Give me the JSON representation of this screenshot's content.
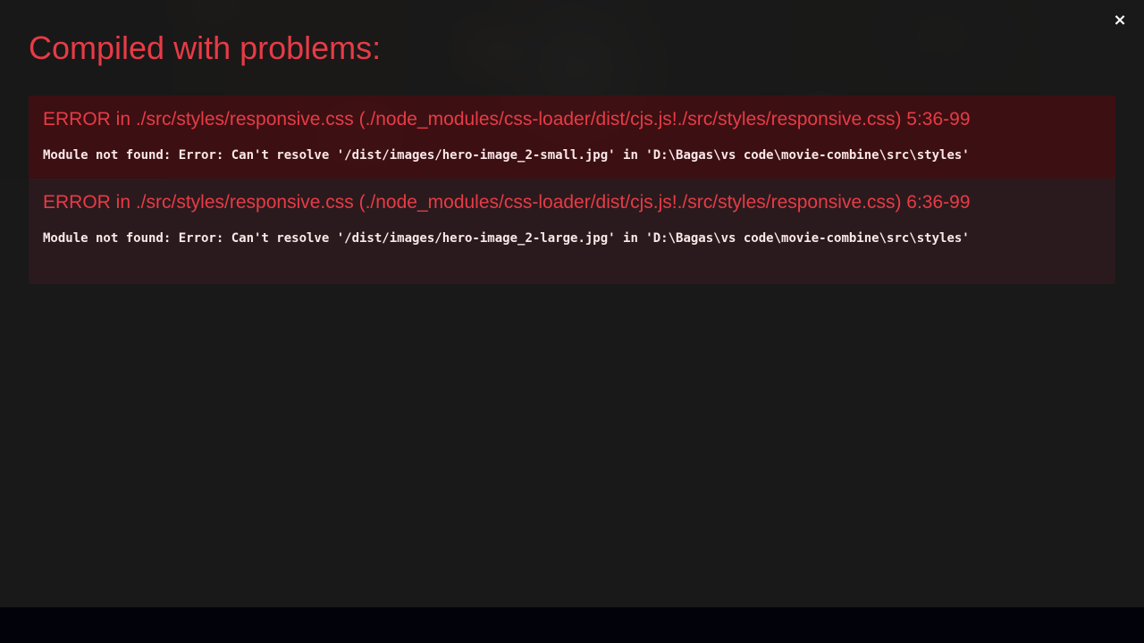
{
  "overlay": {
    "title": "Compiled with problems:",
    "close_label": "×"
  },
  "errors": [
    {
      "header": "ERROR in ./src/styles/responsive.css (./node_modules/css-loader/dist/cjs.js!./src/styles/responsive.css) 5:36-99",
      "message": "Module not found: Error: Can't resolve '/dist/images/hero-image_2-small.jpg' in 'D:\\Bagas\\vs code\\movie-combine\\src\\styles'"
    },
    {
      "header": "ERROR in ./src/styles/responsive.css (./node_modules/css-loader/dist/cjs.js!./src/styles/responsive.css) 6:36-99",
      "message": "Module not found: Error: Can't resolve '/dist/images/hero-image_2-large.jpg' in 'D:\\Bagas\\vs code\\movie-combine\\src\\styles'"
    }
  ],
  "colors": {
    "error_red": "#e83b46",
    "overlay_bg": "#191919",
    "message_text": "#fce8e8"
  },
  "icons": {
    "close": "close-icon"
  }
}
